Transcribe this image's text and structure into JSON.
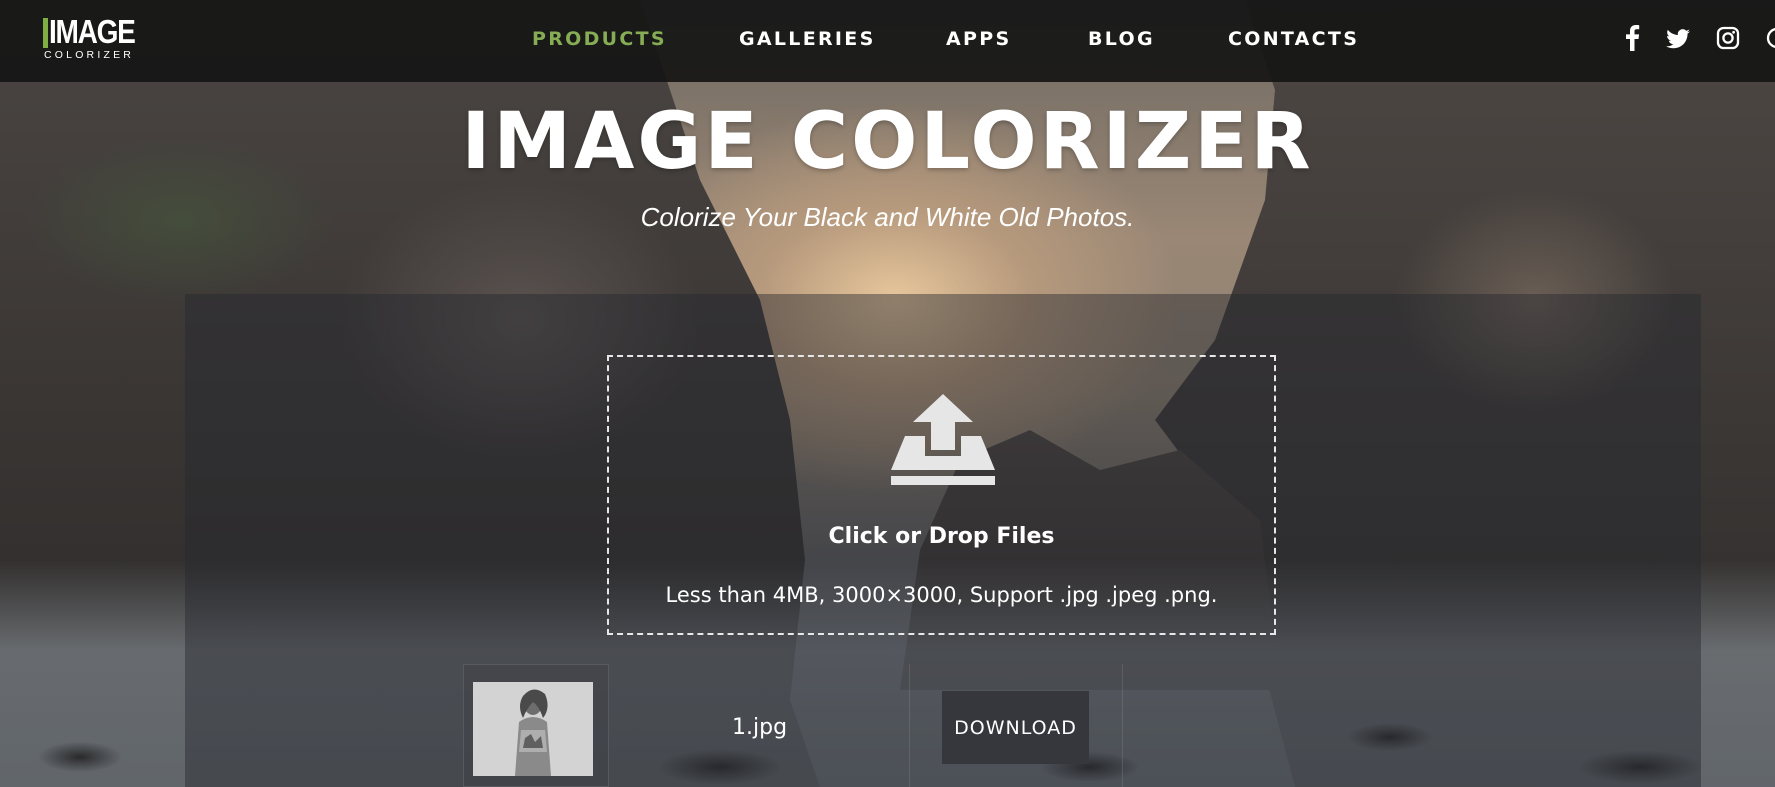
{
  "logo": {
    "word": "IMAGE",
    "sub": "COLORIZER"
  },
  "nav": {
    "items": [
      {
        "label": "PRODUCTS",
        "active": true
      },
      {
        "label": "GALLERIES",
        "active": false
      },
      {
        "label": "APPS",
        "active": false
      },
      {
        "label": "BLOG",
        "active": false
      },
      {
        "label": "CONTACTS",
        "active": false
      }
    ],
    "active_color": "#86ad55",
    "social_icons": [
      "facebook-icon",
      "twitter-icon",
      "instagram-icon",
      "extra-social-icon"
    ]
  },
  "hero": {
    "title": "IMAGE COLORIZER",
    "subtitle": "Colorize Your Black and White Old Photos."
  },
  "upload": {
    "icon": "upload-tray-icon",
    "title": "Click or Drop Files",
    "hint": "Less than 4MB, 3000×3000, Support .jpg .jpeg .png."
  },
  "files": [
    {
      "name": "1.jpg",
      "action_label": "DOWNLOAD"
    }
  ],
  "colors": {
    "accent": "#7fae45",
    "button": "#35373c",
    "navbar": "#161616"
  }
}
